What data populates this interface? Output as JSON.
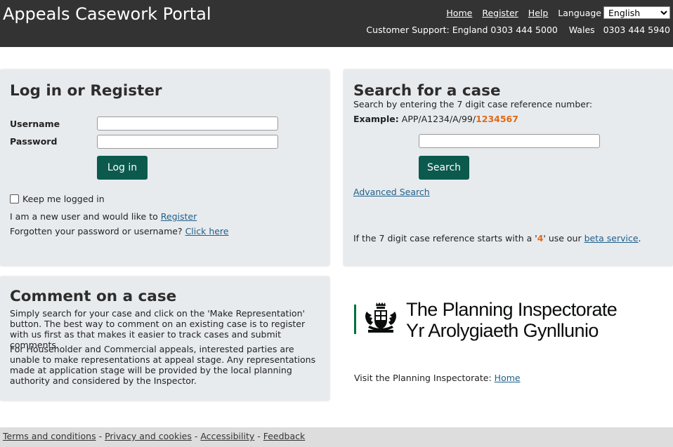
{
  "header": {
    "title": "Appeals Casework Portal",
    "nav": {
      "home": "Home",
      "register": "Register",
      "help": "Help"
    },
    "language_label": "Language",
    "language_selected": "English",
    "support": "Customer Support: England 0303 444 5000    Wales   0303 444 5940"
  },
  "login": {
    "heading": "Log in or Register",
    "username_label": "Username",
    "password_label": "Password",
    "username_value": "",
    "password_value": "",
    "login_button": "Log in",
    "keep_logged_in": "Keep me logged in",
    "new_user_text": "I am a new user and would like to",
    "register_link": "Register",
    "forgot_text": "Forgotten your password or username?",
    "forgot_link": "Click here"
  },
  "search": {
    "heading": "Search for a case",
    "instruction": "Search by entering the 7 digit case reference number:",
    "example_label": "Example:",
    "example_prefix": "APP/A1234/A/99/",
    "example_number": "1234567",
    "input_value": "",
    "search_button": "Search",
    "advanced_link": "Advanced Search",
    "beta_text_1": "If the 7 digit case reference starts with a '",
    "beta_digit": "4",
    "beta_text_2": "' use our",
    "beta_link": "beta service",
    "beta_text_3": "."
  },
  "comment": {
    "heading": "Comment on a case",
    "para1": "Simply search for your case and click on the 'Make Representation' button. The best way to comment on an existing case is to register with us first as that makes it easier to track cases and submit comments.",
    "para2": "For Householder and Commercial appeals, interested parties are unable to make representations at appeal stage. Any representations made at application stage will be provided by the local planning authority and considered by the Inspector."
  },
  "inspectorate": {
    "logo_line1": "The Planning Inspectorate",
    "logo_line2": "Yr Arolygiaeth Gynllunio",
    "visit_text": "Visit the Planning Inspectorate:",
    "home_link": "Home",
    "icon": "royal-crest-icon"
  },
  "footer": {
    "terms": "Terms and conditions",
    "privacy": "Privacy and cookies",
    "accessibility": "Accessibility",
    "feedback": "Feedback",
    "separator": " - "
  },
  "colors": {
    "header_bg": "#333333",
    "button_bg": "#0b5a4d",
    "panel_bg": "#e8ebee",
    "accent_orange": "#e06a17",
    "logo_bar": "#00703c"
  }
}
